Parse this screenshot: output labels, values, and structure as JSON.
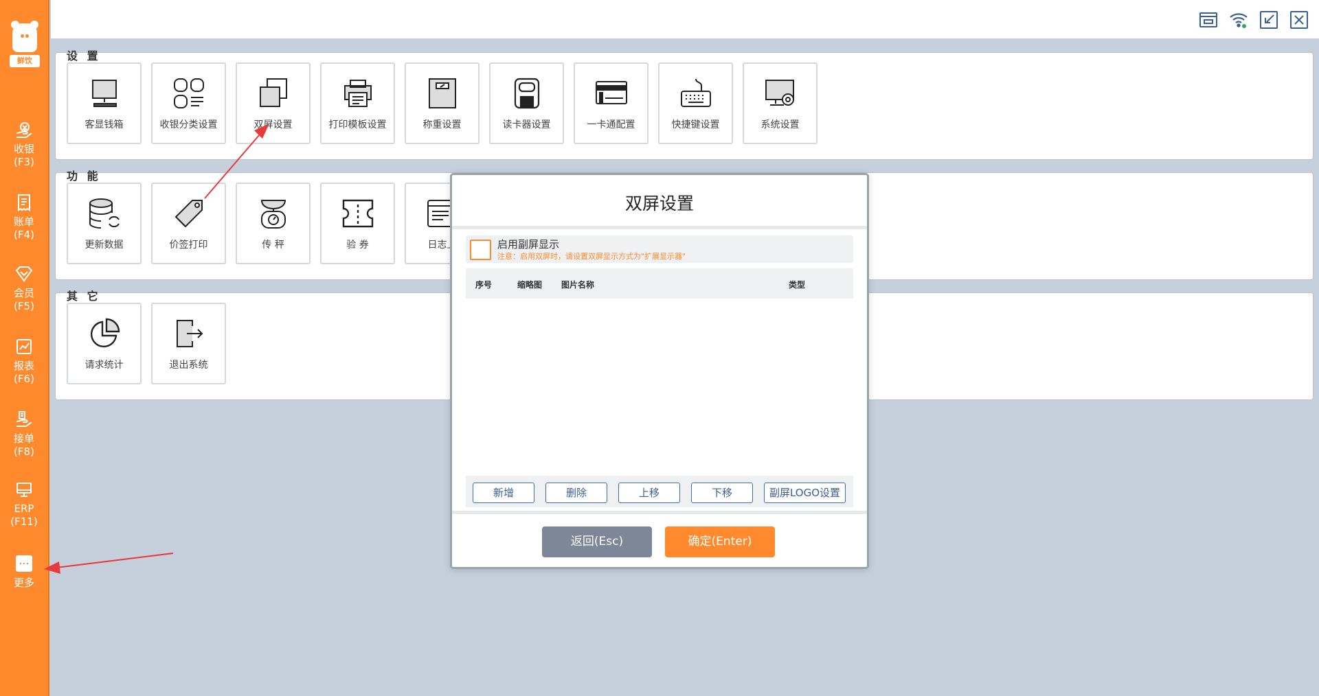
{
  "app": {
    "brand_badge": "鲜饮"
  },
  "sidebar": {
    "items": [
      {
        "label": "收银",
        "key": "(F3)",
        "icon": "cashier-icon"
      },
      {
        "label": "账单",
        "key": "(F4)",
        "icon": "bill-icon"
      },
      {
        "label": "会员",
        "key": "(F5)",
        "icon": "member-icon"
      },
      {
        "label": "报表",
        "key": "(F6)",
        "icon": "report-icon"
      },
      {
        "label": "接单",
        "key": "(F8)",
        "icon": "order-icon"
      },
      {
        "label": "ERP",
        "key": "(F11)",
        "icon": "erp-icon"
      },
      {
        "label": "更多",
        "key": "",
        "icon": "more-icon"
      }
    ]
  },
  "topbar": {
    "icons": [
      "cash-drawer-icon",
      "wifi-icon",
      "shrink-window-icon",
      "close-icon"
    ]
  },
  "sections": {
    "settings": {
      "title": "设 置",
      "tiles": [
        {
          "label": "客显钱箱",
          "icon": "monitor-icon"
        },
        {
          "label": "收银分类设置",
          "icon": "category-icon"
        },
        {
          "label": "双屏设置",
          "icon": "dual-screen-icon"
        },
        {
          "label": "打印模板设置",
          "icon": "printer-icon"
        },
        {
          "label": "称重设置",
          "icon": "scale-icon"
        },
        {
          "label": "读卡器设置",
          "icon": "card-reader-icon"
        },
        {
          "label": "一卡通配置",
          "icon": "card-icon"
        },
        {
          "label": "快捷键设置",
          "icon": "keyboard-icon"
        },
        {
          "label": "系统设置",
          "icon": "system-settings-icon"
        }
      ]
    },
    "functions": {
      "title": "功 能",
      "tiles": [
        {
          "label": "更新数据",
          "icon": "database-refresh-icon"
        },
        {
          "label": "价签打印",
          "icon": "price-tag-icon"
        },
        {
          "label": "传 秤",
          "icon": "weigh-icon"
        },
        {
          "label": "验 券",
          "icon": "coupon-icon"
        },
        {
          "label": "日志上",
          "icon": "log-icon"
        }
      ]
    },
    "others": {
      "title": "其 它",
      "tiles": [
        {
          "label": "请求统计",
          "icon": "pie-chart-icon"
        },
        {
          "label": "退出系统",
          "icon": "exit-icon"
        }
      ]
    }
  },
  "dialog": {
    "title": "双屏设置",
    "enable_label": "启用副屏显示",
    "enable_note": "注意：启用双屏时，请设置双屏显示方式为\"扩展显示器\"",
    "enable_checked": false,
    "table_headers": [
      "序号",
      "缩略图",
      "图片名称",
      "类型"
    ],
    "table_rows": [],
    "buttons": [
      "新增",
      "删除",
      "上移",
      "下移",
      "副屏LOGO设置"
    ],
    "cancel_label": "返回(Esc)",
    "confirm_label": "确定(Enter)",
    "colors": {
      "cancel": "#7e8798",
      "confirm": "#ff8a2e"
    }
  },
  "colors": {
    "accent": "#ff8a2e",
    "background": "#c5d0dc",
    "annotation_arrow": "#e83a3a"
  }
}
